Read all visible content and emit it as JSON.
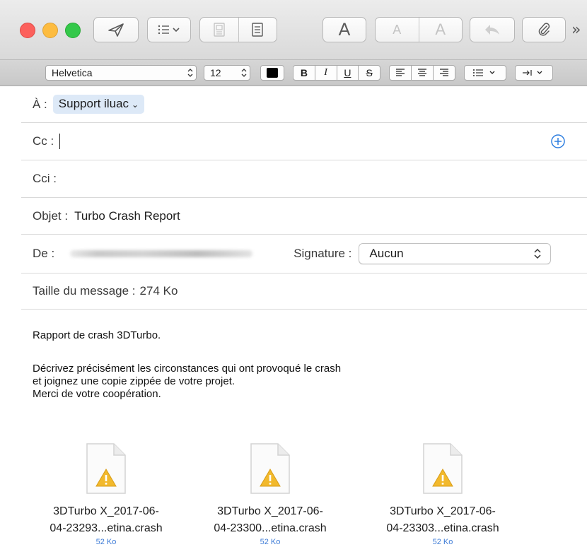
{
  "toolbar": {
    "buttons": [
      {
        "name": "send-button",
        "icon": "paper-plane-icon"
      },
      {
        "name": "header-fields-button",
        "icon": "list-menu-icon"
      },
      {
        "name": "stationery-button",
        "icon": "stationery-icon"
      },
      {
        "name": "format-bar-toggle",
        "icon": "text-format-icon"
      },
      {
        "name": "font-button",
        "icon": "font-A-icon"
      },
      {
        "name": "text-size-buttons",
        "icon": "text-size-icon"
      },
      {
        "name": "reply-button",
        "icon": "reply-arrow-icon"
      },
      {
        "name": "attach-button",
        "icon": "paperclip-icon"
      }
    ],
    "font_label": "A",
    "smaller_label": "A",
    "larger_label": "A",
    "overflow_label": "»"
  },
  "format_bar": {
    "font_family": "Helvetica",
    "font_size": "12",
    "text_color": "#000000",
    "bold": "B",
    "italic": "I",
    "underline": "U",
    "strike": "S"
  },
  "header": {
    "to_label": "À :",
    "to_recipient": "Support iluac",
    "cc_label": "Cc :",
    "bcc_label": "Cci :",
    "subject_label": "Objet :",
    "subject_value": "Turbo Crash Report",
    "from_label": "De :",
    "signature_label": "Signature :",
    "signature_value": "Aucun",
    "size_label": "Taille du message :",
    "size_value": "274 Ko"
  },
  "message": {
    "line1": "Rapport de crash 3DTurbo.",
    "line2": "Décrivez précisément les circonstances qui ont provoqué le crash",
    "line3": "et joignez une copie zippée de votre projet.",
    "line4": "Merci de votre coopération."
  },
  "attachments": [
    {
      "name_line1": "3DTurbo X_2017-06-",
      "name_line2": "04-23293...etina.crash",
      "size": "52 Ko"
    },
    {
      "name_line1": "3DTurbo X_2017-06-",
      "name_line2": "04-23300...etina.crash",
      "size": "52 Ko"
    },
    {
      "name_line1": "3DTurbo X_2017-06-",
      "name_line2": "04-23303...etina.crash",
      "size": "52 Ko"
    }
  ],
  "colors": {
    "accent": "#2f7fe0",
    "token_bg": "#dde9f7",
    "warning": "#f2b92c"
  }
}
